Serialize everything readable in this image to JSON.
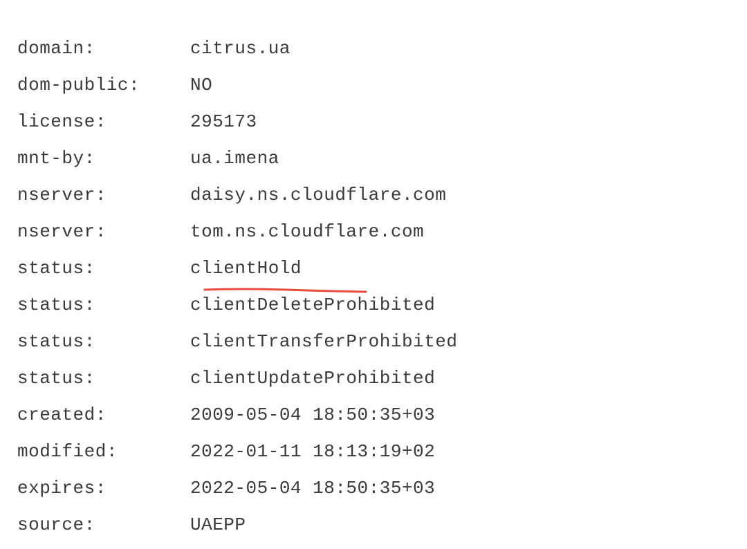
{
  "rows": [
    {
      "label": "domain:",
      "value": "citrus.ua"
    },
    {
      "label": "dom-public:",
      "value": "NO"
    },
    {
      "label": "license:",
      "value": "295173"
    },
    {
      "label": "mnt-by:",
      "value": "ua.imena"
    },
    {
      "label": "nserver:",
      "value": "daisy.ns.cloudflare.com"
    },
    {
      "label": "nserver:",
      "value": "tom.ns.cloudflare.com"
    },
    {
      "label": "status:",
      "value": "clientHold",
      "underlined": true
    },
    {
      "label": "status:",
      "value": "clientDeleteProhibited"
    },
    {
      "label": "status:",
      "value": "clientTransferProhibited"
    },
    {
      "label": "status:",
      "value": "clientUpdateProhibited"
    },
    {
      "label": "created:",
      "value": "2009-05-04 18:50:35+03"
    },
    {
      "label": "modified:",
      "value": "2022-01-11 18:13:19+02"
    },
    {
      "label": "expires:",
      "value": "2022-05-04 18:50:35+03"
    },
    {
      "label": "source:",
      "value": "UAEPP"
    }
  ],
  "underline_color": "#e74c3c"
}
